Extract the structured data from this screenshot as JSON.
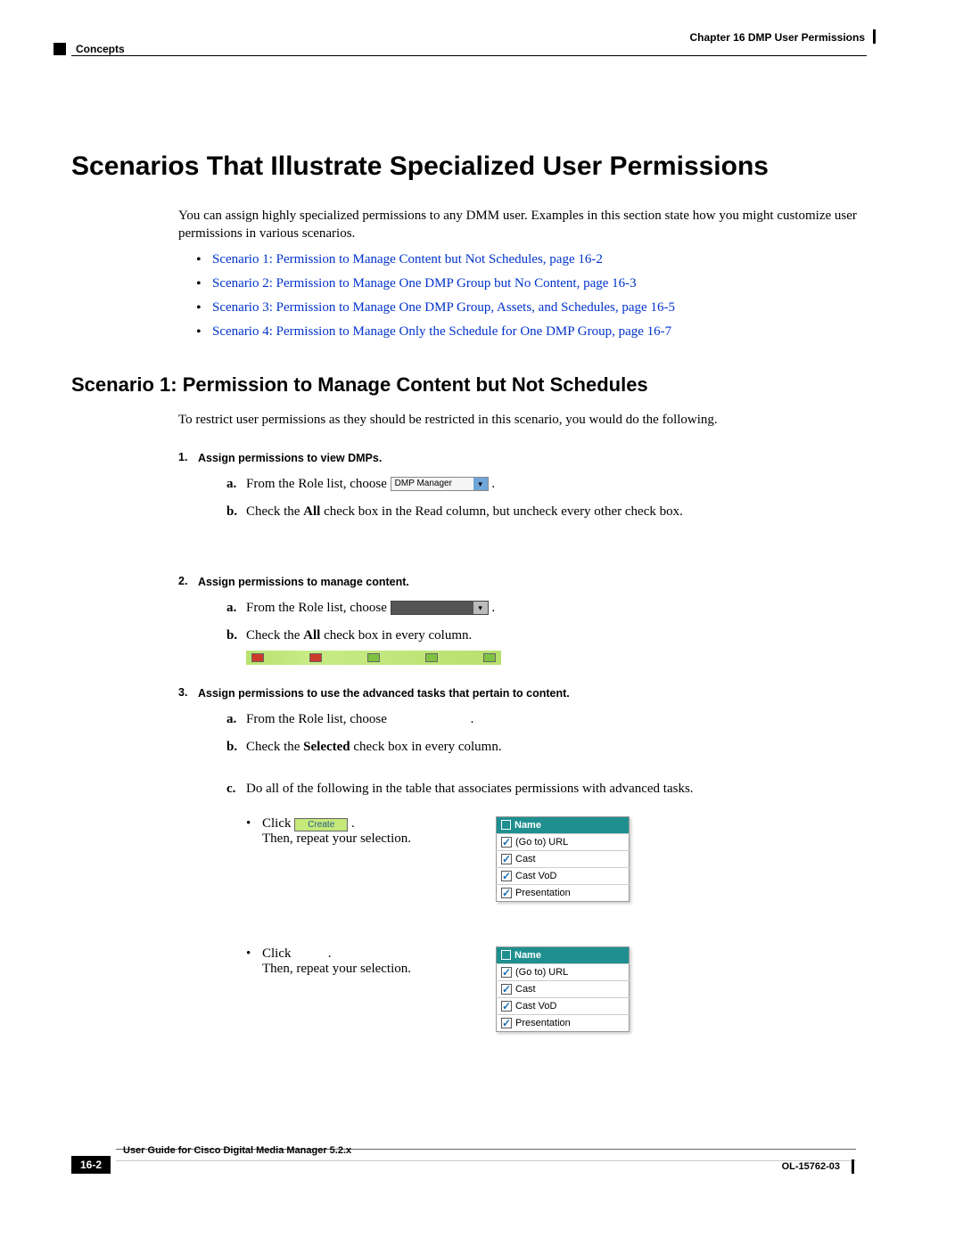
{
  "header": {
    "concepts": "Concepts",
    "chapter": "Chapter 16    DMP User Permissions"
  },
  "title": "Scenarios That Illustrate Specialized User Permissions",
  "intro": "You can assign highly specialized permissions to any DMM user. Examples in this section state how you might customize user permissions in various scenarios.",
  "links": [
    "Scenario 1: Permission to Manage Content but Not Schedules, page 16-2",
    "Scenario 2: Permission to Manage One DMP Group but No Content, page 16-3",
    "Scenario 3: Permission to Manage One DMP Group, Assets, and Schedules, page 16-5",
    "Scenario 4: Permission to Manage Only the Schedule for One DMP Group, page 16-7"
  ],
  "scenario1": {
    "title": "Scenario 1: Permission to Manage Content but Not Schedules",
    "lead": "To restrict user permissions as they should be restricted in this scenario, you would do the following.",
    "step1": {
      "num": "1.",
      "title": "Assign permissions to view DMPs.",
      "a_prefix": "From the Role list, choose",
      "dropdown": "DMP Manager",
      "b_prefix": "Check the ",
      "b_bold": "All",
      "b_suffix": " check box in the Read column, but uncheck every other check box."
    },
    "step2": {
      "num": "2.",
      "title": "Assign permissions to manage content.",
      "a": "From the Role list, choose",
      "b_prefix": "Check the ",
      "b_bold": "All",
      "b_suffix": " check box in every column."
    },
    "step3": {
      "num": "3.",
      "title": "Assign permissions to use the advanced tasks that pertain to content.",
      "a": "From the Role list, choose",
      "b_prefix": "Check the ",
      "b_bold": "Selected",
      "b_suffix": " check box in every column.",
      "c": "Do all of the following in the table that associates permissions with advanced tasks.",
      "click": "Click ",
      "create": "Create",
      "repeat": "Then, repeat your selection.",
      "click2": "Click",
      "table_header": "Name",
      "rows": [
        "(Go to) URL",
        "Cast",
        "Cast VoD",
        "Presentation"
      ]
    }
  },
  "footer": {
    "guide": "User Guide for Cisco Digital Media Manager 5.2.x",
    "page": "16-2",
    "doc": "OL-15762-03"
  }
}
